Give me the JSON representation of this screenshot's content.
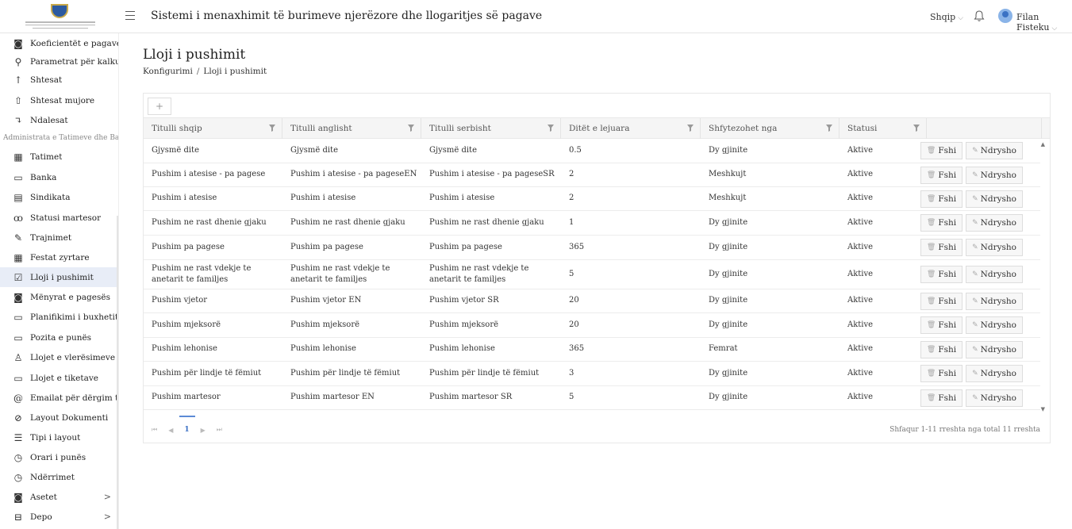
{
  "header": {
    "title": "Sistemi i menaxhimit të burimeve njerëzore dhe llogaritjes së pagave",
    "language": "Shqip",
    "user_name": "Filan Fisteku",
    "chevron": "⌵",
    "icons": {
      "menu": "menu-icon",
      "bell": "bell-icon",
      "avatar": "avatar"
    }
  },
  "sidebar": {
    "items": [
      {
        "label": "Koeficientët e pagave",
        "icon": "◙"
      },
      {
        "label": "Parametrat për kalkulim",
        "icon": "⚲"
      },
      {
        "label": "Shtesat",
        "icon": "↑"
      },
      {
        "label": "Shtesat mujore",
        "icon": "⇧"
      },
      {
        "label": "Ndalesat",
        "icon": "↴"
      },
      {
        "label": "Tatimet",
        "icon": "▦"
      },
      {
        "label": "Banka",
        "icon": "▭"
      },
      {
        "label": "Sindikata",
        "icon": "▤"
      },
      {
        "label": "Statusi martesor",
        "icon": "ꝏ"
      },
      {
        "label": "Trajnimet",
        "icon": "✎"
      },
      {
        "label": "Festat zyrtare",
        "icon": "▦"
      },
      {
        "label": "Lloji i pushimit",
        "icon": "☑"
      },
      {
        "label": "Mënyrat e pagesës",
        "icon": "◙"
      },
      {
        "label": "Planifikimi i buxhetit",
        "icon": "▭"
      },
      {
        "label": "Pozita e punës",
        "icon": "▭"
      },
      {
        "label": "Llojet e vlerësimeve",
        "icon": "♙"
      },
      {
        "label": "Llojet e tiketave",
        "icon": "▭"
      },
      {
        "label": "Emailat për dërgim të raporteve",
        "icon": "@"
      },
      {
        "label": "Layout Dokumenti",
        "icon": "⊘"
      },
      {
        "label": "Tipi i layout",
        "icon": "☰"
      },
      {
        "label": "Orari i punës",
        "icon": "◷"
      },
      {
        "label": "Ndërrimet",
        "icon": "◷"
      },
      {
        "label": "Asetet",
        "icon": "◙",
        "arrow": ">"
      },
      {
        "label": "Depo",
        "icon": "⊟",
        "arrow": ">"
      }
    ],
    "section_label": "Administrata e Tatimeve dhe Bankave",
    "active": "Lloji i pushimit"
  },
  "page": {
    "title": "Lloji i pushimit",
    "breadcrumb": [
      "Konfigurimi",
      "Lloji i pushimit"
    ],
    "breadcrumb_sep": "/"
  },
  "toolbar": {
    "add_label": "+"
  },
  "table": {
    "columns": [
      "Titulli shqip",
      "Titulli anglisht",
      "Titulli serbisht",
      "Ditët e lejuara",
      "Shfytezohet nga",
      "Statusi"
    ],
    "rows": [
      [
        "Gjysmë dite",
        "Gjysmë dite",
        "Gjysmë dite",
        "0.5",
        "Dy gjinite",
        "Aktive"
      ],
      [
        "Pushim i atesise - pa pagese",
        "Pushim i atesise - pa pageseEN",
        "Pushim i atesise - pa pageseSR",
        "2",
        "Meshkujt",
        "Aktive"
      ],
      [
        "Pushim i atesise",
        "Pushim i atesise",
        "Pushim i atesise",
        "2",
        "Meshkujt",
        "Aktive"
      ],
      [
        "Pushim ne rast dhenie gjaku",
        "Pushim ne rast dhenie gjaku",
        "Pushim ne rast dhenie gjaku",
        "1",
        "Dy gjinite",
        "Aktive"
      ],
      [
        "Pushim pa pagese",
        "Pushim pa pagese",
        "Pushim pa pagese",
        "365",
        "Dy gjinite",
        "Aktive"
      ],
      [
        "Pushim ne rast vdekje te anetarit te familjes",
        "Pushim ne rast vdekje te anetarit te familjes",
        "Pushim ne rast vdekje te anetarit te familjes",
        "5",
        "Dy gjinite",
        "Aktive"
      ],
      [
        "Pushim vjetor",
        "Pushim vjetor EN",
        "Pushim vjetor SR",
        "20",
        "Dy gjinite",
        "Aktive"
      ],
      [
        "Pushim mjeksorë",
        "Pushim mjeksorë",
        "Pushim mjeksorë",
        "20",
        "Dy gjinite",
        "Aktive"
      ],
      [
        "Pushim lehonise",
        "Pushim lehonise",
        "Pushim lehonise",
        "365",
        "Femrat",
        "Aktive"
      ],
      [
        "Pushim për lindje të fëmiut",
        "Pushim për lindje të fëmiut",
        "Pushim për lindje të fëmiut",
        "3",
        "Dy gjinite",
        "Aktive"
      ],
      [
        "Pushim martesor",
        "Pushim martesor EN",
        "Pushim martesor SR",
        "5",
        "Dy gjinite",
        "Aktive"
      ]
    ],
    "delete_label": "Fshi",
    "edit_label": "Ndrysho",
    "delete_icon": "🗑",
    "edit_icon": "✎"
  },
  "pager": {
    "first": "⏮",
    "prev": "◀",
    "current": "1",
    "next": "▶",
    "last": "⏭",
    "summary": "Shfaqur 1-11 rreshta nga total 11 rreshta"
  },
  "scrollbar": {
    "up": "▲",
    "down": "▼"
  },
  "colors": {
    "active_bg": "#e8edf7",
    "accent": "#3a6fc4"
  }
}
